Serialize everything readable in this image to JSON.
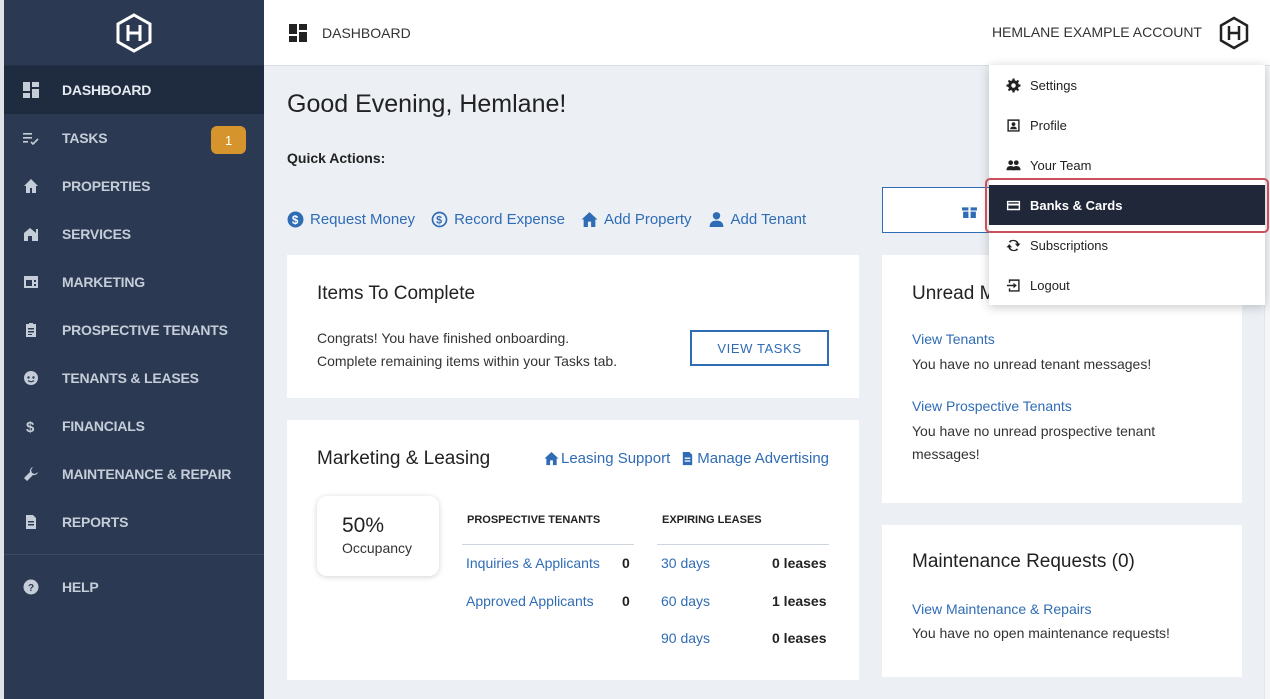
{
  "header": {
    "title": "DASHBOARD",
    "account_name": "HEMLANE EXAMPLE ACCOUNT"
  },
  "sidebar": {
    "items": [
      {
        "label": "DASHBOARD",
        "icon": "dashboard-icon",
        "active": true
      },
      {
        "label": "TASKS",
        "icon": "tasks-icon",
        "badge": "1"
      },
      {
        "label": "PROPERTIES",
        "icon": "home-icon"
      },
      {
        "label": "SERVICES",
        "icon": "services-icon"
      },
      {
        "label": "MARKETING",
        "icon": "marketing-icon"
      },
      {
        "label": "PROSPECTIVE TENANTS",
        "icon": "clipboard-icon"
      },
      {
        "label": "TENANTS & LEASES",
        "icon": "tenant-face-icon"
      },
      {
        "label": "FINANCIALS",
        "icon": "dollar-icon"
      },
      {
        "label": "MAINTENANCE & REPAIR",
        "icon": "wrench-icon"
      },
      {
        "label": "REPORTS",
        "icon": "document-icon"
      }
    ],
    "help_label": "HELP"
  },
  "main": {
    "greeting": "Good Evening, Hemlane!",
    "quick_actions_label": "Quick Actions:",
    "quick_actions": [
      {
        "label": "Request Money",
        "icon": "dollar-circle-icon"
      },
      {
        "label": "Record Expense",
        "icon": "dollar-circle-outline-icon"
      },
      {
        "label": "Add Property",
        "icon": "home-icon"
      },
      {
        "label": "Add Tenant",
        "icon": "person-icon"
      }
    ],
    "items_card": {
      "title": "Items To Complete",
      "line1": "Congrats! You have finished onboarding.",
      "line2": "Complete remaining items within your Tasks tab.",
      "button": "VIEW TASKS"
    },
    "marketing_card": {
      "title": "Marketing & Leasing",
      "link1": "Leasing Support",
      "link2": "Manage Advertising",
      "occupancy_pct": "50%",
      "occupancy_label": "Occupancy",
      "prospective_header": "PROSPECTIVE TENANTS",
      "expiring_header": "EXPIRING LEASES",
      "prospective_rows": [
        {
          "label": "Inquiries & Applicants",
          "value": "0"
        },
        {
          "label": "Approved Applicants",
          "value": "0"
        }
      ],
      "expiring_rows": [
        {
          "label": "30 days",
          "value": "0 leases"
        },
        {
          "label": "60 days",
          "value": "1 leases"
        },
        {
          "label": "90 days",
          "value": "0 leases"
        }
      ]
    },
    "unread_card": {
      "title": "Unread M",
      "link1": "View Tenants",
      "msg1": "You have no unread tenant messages!",
      "link2": "View Prospective Tenants",
      "msg2": "You have no unread prospective tenant messages!"
    },
    "maintenance_card": {
      "title": "Maintenance Requests (0)",
      "link": "View Maintenance & Repairs",
      "msg": "You have no open maintenance requests!"
    }
  },
  "dropdown": {
    "items": [
      {
        "label": "Settings",
        "icon": "gear-icon"
      },
      {
        "label": "Profile",
        "icon": "profile-card-icon"
      },
      {
        "label": "Your Team",
        "icon": "team-icon"
      },
      {
        "label": "Banks & Cards",
        "icon": "credit-card-icon",
        "selected": true
      },
      {
        "label": "Subscriptions",
        "icon": "refresh-icon"
      },
      {
        "label": "Logout",
        "icon": "logout-icon"
      }
    ]
  },
  "colors": {
    "sidebar_bg": "#2b3a52",
    "accent": "#2f6cb5",
    "badge": "#d6952c",
    "selected_bg": "#1f2738",
    "highlight_border": "#c9505c"
  }
}
